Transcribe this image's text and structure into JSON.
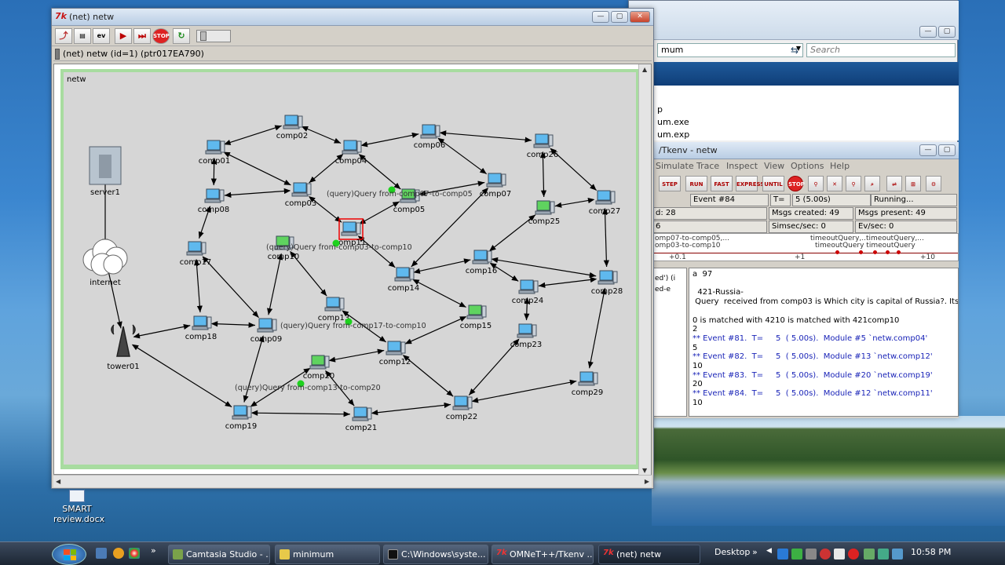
{
  "explorer": {
    "address_value": "mum",
    "search_placeholder": "Search",
    "list_items": [
      "p",
      "um.exe",
      "um.exp"
    ]
  },
  "tkenv": {
    "title": "/Tkenv - netw",
    "menu": [
      "Simulate",
      "Trace",
      "Inspect",
      "View",
      "Options",
      "Help"
    ],
    "toolbar": [
      "STEP",
      "RUN",
      "FAST",
      "EXPRESS",
      "UNTIL",
      "STOP"
    ],
    "status": {
      "event": "Event #84",
      "t_label": "T=",
      "t_value": "5 (5.00s)",
      "running": "Running...",
      "row2_left": "d: 28",
      "msgs_created": "Msgs created: 49",
      "msgs_present": "Msgs present: 49",
      "row3_left": "6",
      "simsec": "Simsec/sec: 0",
      "evsec": "Ev/sec: 0"
    },
    "timeline": {
      "labels_left": [
        "omp07-to-comp05,...",
        "omp03-to-comp10"
      ],
      "labels_right_top": "timeoutQuery,..timeoutQuery,...",
      "labels_right_bottom": "timeoutQuery   timeoutQuery",
      "ticks": [
        "+0.1",
        "+1",
        "+10"
      ]
    },
    "left_pane": [
      "ed') (i",
      "ed-e"
    ],
    "log": [
      {
        "text": "a  97",
        "blue": false
      },
      {
        "text": "",
        "blue": false
      },
      {
        "text": "  421-Russia-",
        "blue": false
      },
      {
        "text": " Query  received from comp03 is Which city is capital of Russia?. Its val is 421",
        "blue": false
      },
      {
        "text": "",
        "blue": false
      },
      {
        "text": "0 is matched with 4210 is matched with 421comp10",
        "blue": false
      },
      {
        "text": "2",
        "blue": false
      },
      {
        "text": "** Event #81.  T=     5  ( 5.00s).  Module #5 `netw.comp04'",
        "blue": true
      },
      {
        "text": "5",
        "blue": false
      },
      {
        "text": "** Event #82.  T=     5  ( 5.00s).  Module #13 `netw.comp12'",
        "blue": true
      },
      {
        "text": "10",
        "blue": false
      },
      {
        "text": "** Event #83.  T=     5  ( 5.00s).  Module #20 `netw.comp19'",
        "blue": true
      },
      {
        "text": "20",
        "blue": false
      },
      {
        "text": "** Event #84.  T=     5  ( 5.00s).  Module #12 `netw.comp11'",
        "blue": true
      },
      {
        "text": "10",
        "blue": false
      }
    ]
  },
  "netwin": {
    "title": "(net) netw",
    "path": "(net) netw  (id=1)  (ptr017EA790)",
    "canvas_label": "netw",
    "nodes": [
      {
        "id": "server1",
        "label": "server1",
        "kind": "server"
      },
      {
        "id": "internet",
        "label": "internet",
        "kind": "cloud"
      },
      {
        "id": "tower01",
        "label": "tower01",
        "kind": "tower"
      },
      {
        "id": "comp01",
        "label": "comp01",
        "kind": "pc"
      },
      {
        "id": "comp02",
        "label": "comp02",
        "kind": "pc"
      },
      {
        "id": "comp03",
        "label": "comp03",
        "kind": "pc"
      },
      {
        "id": "comp04",
        "label": "comp04",
        "kind": "pc"
      },
      {
        "id": "comp05",
        "label": "comp05",
        "kind": "pc-green"
      },
      {
        "id": "comp06",
        "label": "comp06",
        "kind": "pc"
      },
      {
        "id": "comp07",
        "label": "comp07",
        "kind": "pc"
      },
      {
        "id": "comp08",
        "label": "comp08",
        "kind": "pc"
      },
      {
        "id": "comp09",
        "label": "comp09",
        "kind": "pc"
      },
      {
        "id": "comp10",
        "label": "comp10",
        "kind": "pc-green"
      },
      {
        "id": "comp11",
        "label": "comp11",
        "kind": "pc-selected"
      },
      {
        "id": "comp12",
        "label": "comp12",
        "kind": "pc"
      },
      {
        "id": "comp13",
        "label": "comp13",
        "kind": "pc"
      },
      {
        "id": "comp14",
        "label": "comp14",
        "kind": "pc"
      },
      {
        "id": "comp15",
        "label": "comp15",
        "kind": "pc-green"
      },
      {
        "id": "comp16",
        "label": "comp16",
        "kind": "pc"
      },
      {
        "id": "comp17",
        "label": "comp17",
        "kind": "pc"
      },
      {
        "id": "comp18",
        "label": "comp18",
        "kind": "pc"
      },
      {
        "id": "comp19",
        "label": "comp19",
        "kind": "pc"
      },
      {
        "id": "comp20",
        "label": "comp20",
        "kind": "pc-green"
      },
      {
        "id": "comp21",
        "label": "comp21",
        "kind": "pc"
      },
      {
        "id": "comp22",
        "label": "comp22",
        "kind": "pc"
      },
      {
        "id": "comp23",
        "label": "comp23",
        "kind": "pc"
      },
      {
        "id": "comp24",
        "label": "comp24",
        "kind": "pc"
      },
      {
        "id": "comp25",
        "label": "comp25",
        "kind": "pc-green"
      },
      {
        "id": "comp26",
        "label": "comp26",
        "kind": "pc"
      },
      {
        "id": "comp27",
        "label": "comp27",
        "kind": "pc"
      },
      {
        "id": "comp28",
        "label": "comp28",
        "kind": "pc"
      },
      {
        "id": "comp29",
        "label": "comp29",
        "kind": "pc"
      }
    ],
    "links": [
      [
        "server1",
        "internet"
      ],
      [
        "internet",
        "tower01"
      ],
      [
        "tower01",
        "comp18"
      ],
      [
        "tower01",
        "comp19"
      ],
      [
        "comp01",
        "comp02"
      ],
      [
        "comp01",
        "comp08"
      ],
      [
        "comp01",
        "comp03"
      ],
      [
        "comp02",
        "comp04"
      ],
      [
        "comp04",
        "comp06"
      ],
      [
        "comp04",
        "comp03"
      ],
      [
        "comp04",
        "comp05"
      ],
      [
        "comp05",
        "comp07"
      ],
      [
        "comp06",
        "comp26"
      ],
      [
        "comp06",
        "comp07"
      ],
      [
        "comp26",
        "comp25"
      ],
      [
        "comp26",
        "comp27"
      ],
      [
        "comp03",
        "comp08"
      ],
      [
        "comp03",
        "comp11"
      ],
      [
        "comp08",
        "comp17"
      ],
      [
        "comp17",
        "comp18"
      ],
      [
        "comp17",
        "comp09"
      ],
      [
        "comp18",
        "comp09"
      ],
      [
        "comp11",
        "comp14"
      ],
      [
        "comp11",
        "comp05"
      ],
      [
        "comp10",
        "comp09"
      ],
      [
        "comp10",
        "comp13"
      ],
      [
        "comp13",
        "comp12"
      ],
      [
        "comp07",
        "comp14"
      ],
      [
        "comp14",
        "comp16"
      ],
      [
        "comp14",
        "comp15"
      ],
      [
        "comp16",
        "comp25"
      ],
      [
        "comp16",
        "comp24"
      ],
      [
        "comp16",
        "comp28"
      ],
      [
        "comp27",
        "comp28"
      ],
      [
        "comp27",
        "comp25"
      ],
      [
        "comp28",
        "comp24"
      ],
      [
        "comp28",
        "comp29"
      ],
      [
        "comp24",
        "comp23"
      ],
      [
        "comp23",
        "comp22"
      ],
      [
        "comp15",
        "comp12"
      ],
      [
        "comp12",
        "comp22"
      ],
      [
        "comp22",
        "comp29"
      ],
      [
        "comp09",
        "comp19"
      ],
      [
        "comp19",
        "comp21"
      ],
      [
        "comp20",
        "comp19"
      ],
      [
        "comp20",
        "comp21"
      ],
      [
        "comp20",
        "comp12"
      ],
      [
        "comp21",
        "comp22"
      ]
    ],
    "messages": [
      {
        "label": "(query)Query from-comp07-to-comp05"
      },
      {
        "label": "(query)Query from-comp03-to-comp10"
      },
      {
        "label": "(query)Query from-comp17-to-comp10"
      },
      {
        "label": "(query)Query from-comp13-to-comp20"
      }
    ]
  },
  "desktop_icon": {
    "line1": "SMART",
    "line2": "review.docx"
  },
  "taskbar": {
    "tasks": [
      {
        "label": "Camtasia Studio - ..."
      },
      {
        "label": "minimum"
      },
      {
        "label": "C:\\Windows\\syste..."
      },
      {
        "label": "OMNeT++/Tkenv ..."
      },
      {
        "label": "(net) netw"
      }
    ],
    "desktop": "Desktop",
    "clock": "10:58 PM"
  }
}
